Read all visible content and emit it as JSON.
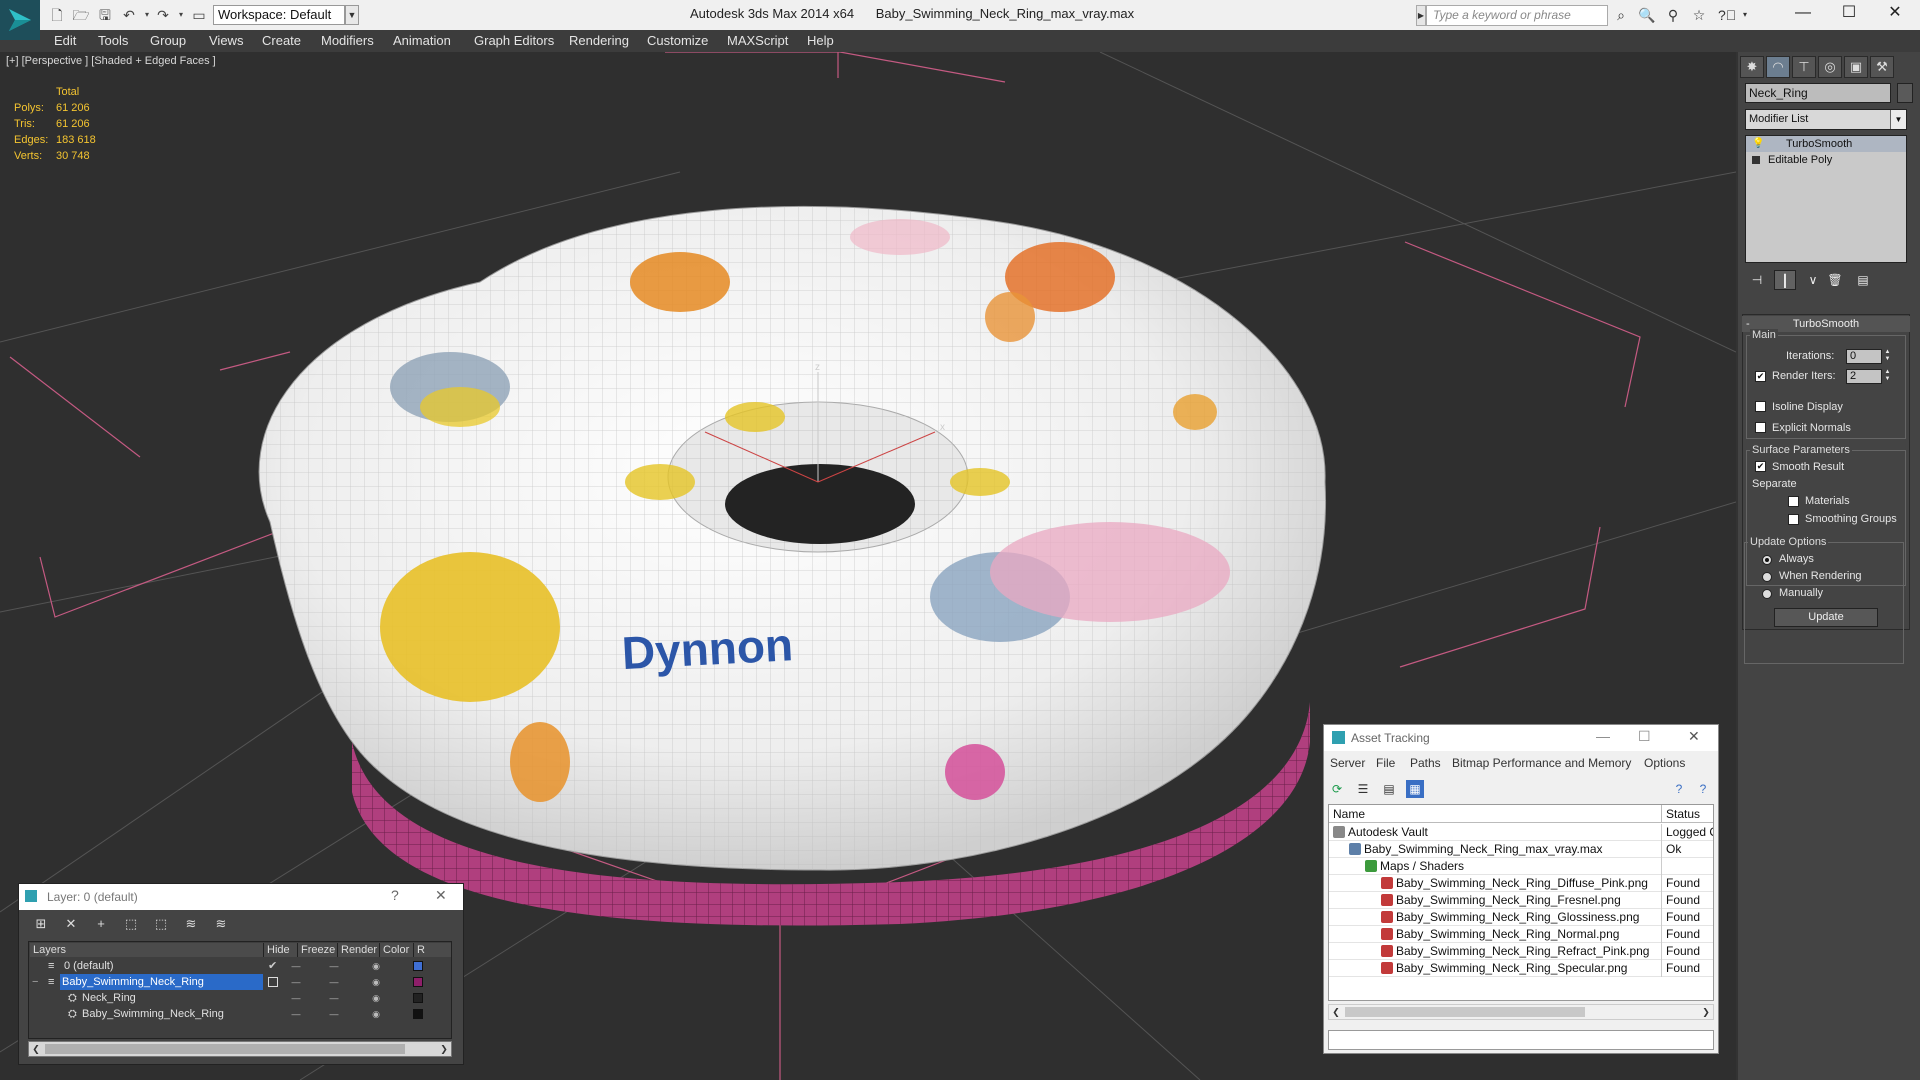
{
  "titlebar": {
    "app_title": "Autodesk 3ds Max 2014 x64",
    "file_name": "Baby_Swimming_Neck_Ring_max_vray.max",
    "workspace": "Workspace: Default",
    "search_placeholder": "Type a keyword or phrase",
    "icons": [
      "new-file-icon",
      "open-file-icon",
      "save-icon",
      "undo-icon",
      "redo-icon",
      "project-folder-icon",
      "infocenter-search-icon",
      "subscription-icon",
      "communication-icon",
      "favorites-icon",
      "help-icon"
    ]
  },
  "menu": [
    "Edit",
    "Tools",
    "Group",
    "Views",
    "Create",
    "Modifiers",
    "Animation",
    "Graph Editors",
    "Rendering",
    "Customize",
    "MAXScript",
    "Help"
  ],
  "viewport": {
    "label": "[+] [Perspective ] [Shaded + Edged Faces ]",
    "stats": {
      "header": "Total",
      "rows": [
        {
          "k": "Polys:",
          "v": "61 206"
        },
        {
          "k": "Tris:",
          "v": "61 206"
        },
        {
          "k": "Edges:",
          "v": "183 618"
        },
        {
          "k": "Verts:",
          "v": "30 748"
        }
      ]
    },
    "logo_text": "Dynnon",
    "axis_z": "z",
    "axis_x": "x",
    "colors": {
      "bg": "#2f2f2f",
      "ring": "#f2f2f2",
      "base": "#b03f7e",
      "grid": "#d0587e"
    }
  },
  "command_panel": {
    "object_name": "Neck_Ring",
    "modifier_list": "Modifier List",
    "stack": [
      "TurboSmooth",
      "Editable Poly"
    ],
    "rollout_title": "TurboSmooth",
    "main_group": "Main",
    "iterations_label": "Iterations:",
    "iterations_value": "0",
    "render_iters_label": "Render Iters:",
    "render_iters_value": "2",
    "isoline_label": "Isoline Display",
    "explicit_label": "Explicit Normals",
    "surface_group": "Surface Parameters",
    "smooth_result_label": "Smooth Result",
    "separate_label": "Separate",
    "materials_label": "Materials",
    "smoothing_groups_label": "Smoothing Groups",
    "update_group": "Update Options",
    "always_label": "Always",
    "when_rendering_label": "When Rendering",
    "manually_label": "Manually",
    "update_button": "Update"
  },
  "layer_dialog": {
    "title": "Layer: 0 (default)",
    "help": "?",
    "close": "✕",
    "columns": [
      "Layers",
      "Hide",
      "Freeze",
      "Render",
      "Color",
      "R"
    ],
    "rows": [
      {
        "name": "0 (default)",
        "color": "#3f6fd4",
        "indent": 1,
        "selected": false
      },
      {
        "name": "Baby_Swimming_Neck_Ring",
        "color": "#8e1f6a",
        "indent": 0,
        "selected": true
      },
      {
        "name": "Neck_Ring",
        "color": "#222222",
        "indent": 2,
        "selected": false
      },
      {
        "name": "Baby_Swimming_Neck_Ring",
        "color": "#111111",
        "indent": 2,
        "selected": false
      }
    ]
  },
  "asset_dialog": {
    "title": "Asset Tracking",
    "menu": [
      "Server",
      "File",
      "Paths",
      "Bitmap Performance and Memory",
      "Options"
    ],
    "columns": [
      "Name",
      "Status"
    ],
    "rows": [
      {
        "name": "Autodesk Vault",
        "status": "Logged Out",
        "indent": 0,
        "icon": "#888888"
      },
      {
        "name": "Baby_Swimming_Neck_Ring_max_vray.max",
        "status": "Ok",
        "indent": 1,
        "icon": "#5d7fa8"
      },
      {
        "name": "Maps / Shaders",
        "status": "",
        "indent": 2,
        "icon": "#3c9a3c"
      },
      {
        "name": "Baby_Swimming_Neck_Ring_Diffuse_Pink.png",
        "status": "Found",
        "indent": 3,
        "icon": "#c23a3a"
      },
      {
        "name": "Baby_Swimming_Neck_Ring_Fresnel.png",
        "status": "Found",
        "indent": 3,
        "icon": "#c23a3a"
      },
      {
        "name": "Baby_Swimming_Neck_Ring_Glossiness.png",
        "status": "Found",
        "indent": 3,
        "icon": "#c23a3a"
      },
      {
        "name": "Baby_Swimming_Neck_Ring_Normal.png",
        "status": "Found",
        "indent": 3,
        "icon": "#c23a3a"
      },
      {
        "name": "Baby_Swimming_Neck_Ring_Refract_Pink.png",
        "status": "Found",
        "indent": 3,
        "icon": "#c23a3a"
      },
      {
        "name": "Baby_Swimming_Neck_Ring_Specular.png",
        "status": "Found",
        "indent": 3,
        "icon": "#c23a3a"
      }
    ]
  }
}
